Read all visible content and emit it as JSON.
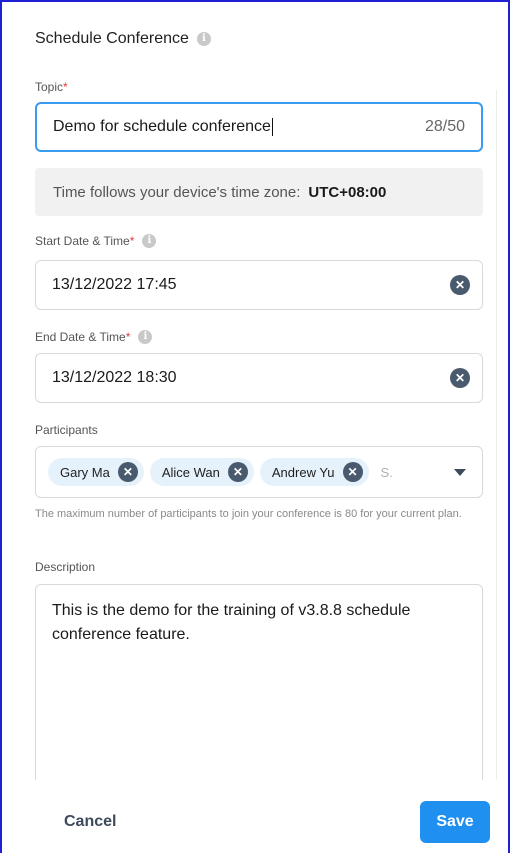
{
  "dialog": {
    "title": "Schedule Conference",
    "topic": {
      "label": "Topic",
      "required_mark": "*",
      "value": "Demo for schedule conference",
      "counter": "28/50"
    },
    "timezone": {
      "text": "Time follows your device's time zone:",
      "value": "UTC+08:00"
    },
    "start": {
      "label": "Start Date & Time",
      "required_mark": "*",
      "value": "13/12/2022 17:45"
    },
    "end": {
      "label": "End Date & Time",
      "required_mark": "*",
      "value": "13/12/2022 18:30"
    },
    "participants": {
      "label": "Participants",
      "chips": [
        "Gary Ma",
        "Alice Wan",
        "Andrew Yu"
      ],
      "search_placeholder": "S.",
      "hint": "The maximum number of participants to join your conference is 80 for your current plan."
    },
    "description": {
      "label": "Description",
      "value": "This is the demo for the training of v3.8.8 schedule conference feature."
    },
    "footer": {
      "cancel_label": "Cancel",
      "save_label": "Save"
    }
  },
  "colors": {
    "accent": "#1f8ff0",
    "focus_border": "#3a9cf0",
    "required": "#e03a3a",
    "chip_bg": "#e6f2fb",
    "clear_icon": "#4a5a6e"
  },
  "icons": {
    "info": "info-icon",
    "clear": "clear-icon",
    "dropdown": "chevron-down-icon"
  }
}
